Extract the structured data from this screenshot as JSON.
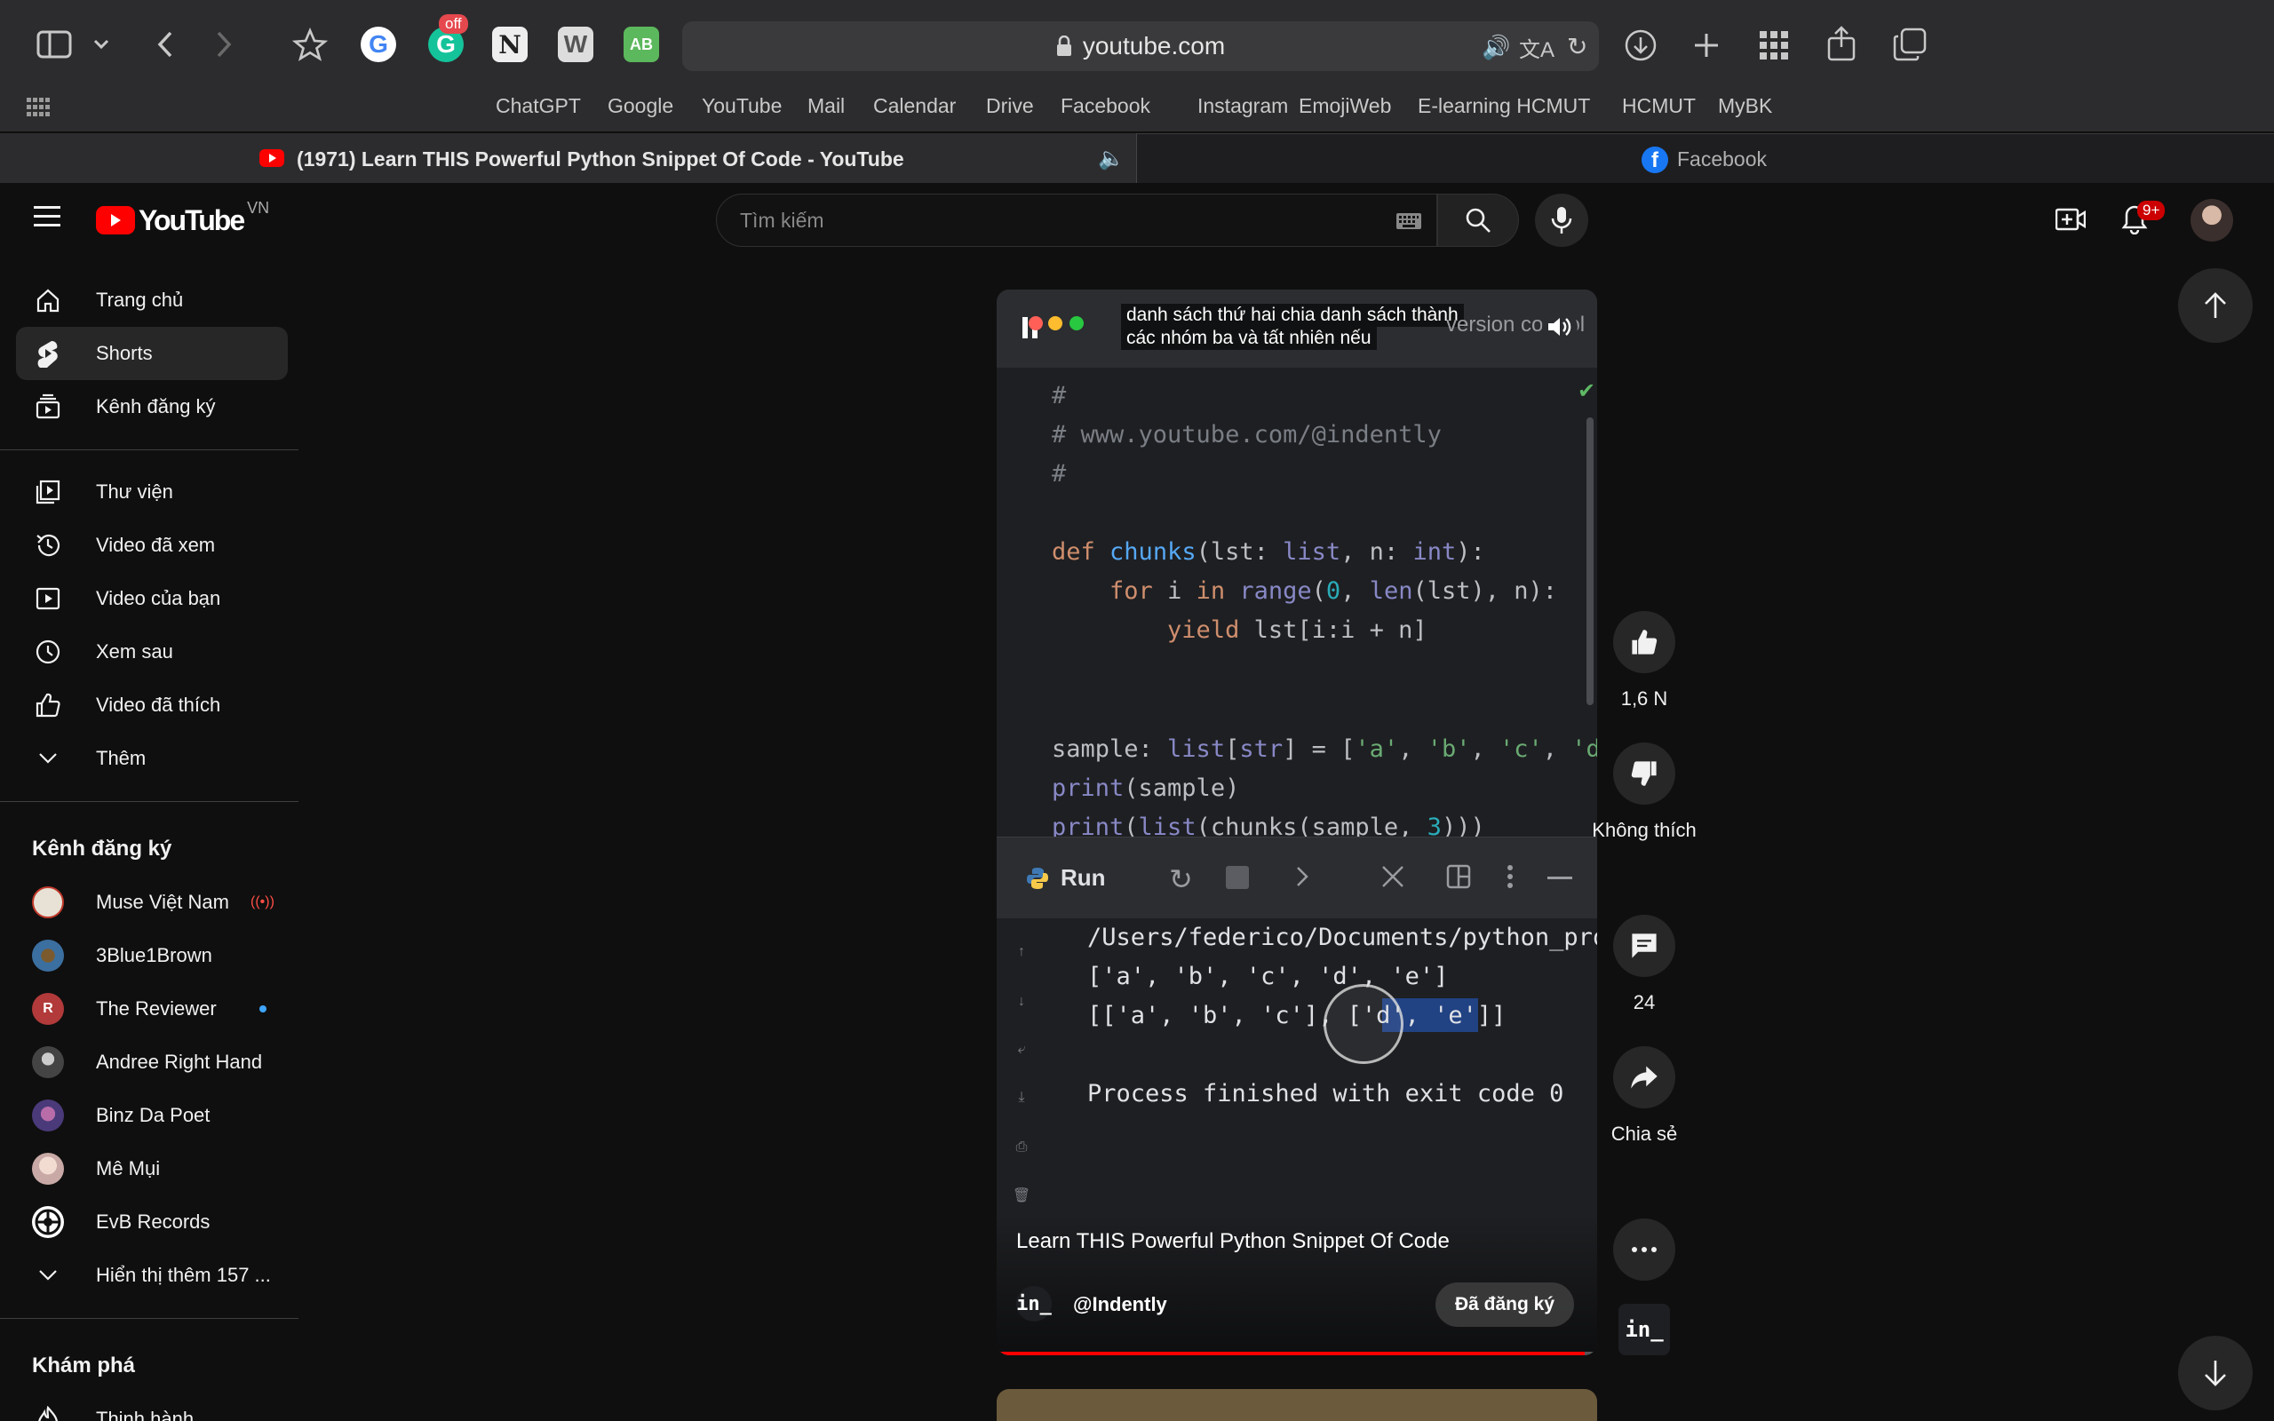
{
  "browser": {
    "address": "youtube.com",
    "extensions": {
      "grammarly_badge": "off"
    },
    "favorites": [
      "ChatGPT",
      "Google",
      "YouTube",
      "Mail",
      "Calendar",
      "Drive",
      "Facebook",
      "Instagram",
      "EmojiWeb",
      "E-learning HCMUT",
      "HCMUT",
      "MyBK"
    ],
    "tabs": [
      {
        "title": "(1971) Learn THIS Powerful Python Snippet Of Code - YouTube",
        "active": true
      },
      {
        "title": "Facebook",
        "active": false
      }
    ]
  },
  "youtube": {
    "logo_text": "YouTube",
    "region": "VN",
    "search_placeholder": "Tìm kiếm",
    "notification_count": "9+"
  },
  "sidebar": {
    "main": [
      {
        "label": "Trang chủ",
        "icon": "home-icon"
      },
      {
        "label": "Shorts",
        "icon": "shorts-icon",
        "selected": true
      },
      {
        "label": "Kênh đăng ký",
        "icon": "subscriptions-icon"
      }
    ],
    "library": [
      {
        "label": "Thư viện",
        "icon": "library-icon"
      },
      {
        "label": "Video đã xem",
        "icon": "history-icon"
      },
      {
        "label": "Video của bạn",
        "icon": "your-videos-icon"
      },
      {
        "label": "Xem sau",
        "icon": "watch-later-icon"
      },
      {
        "label": "Video đã thích",
        "icon": "liked-icon"
      },
      {
        "label": "Thêm",
        "icon": "chevron-down-icon"
      }
    ],
    "subscriptions_heading": "Kênh đăng ký",
    "subscriptions": [
      {
        "name": "Muse Việt Nam",
        "status": "live",
        "color": "#e8e2d6"
      },
      {
        "name": "3Blue1Brown",
        "status": "",
        "color": "#3b6fa0"
      },
      {
        "name": "The Reviewer",
        "status": "new",
        "color": "#b23a3a"
      },
      {
        "name": "Andree Right Hand",
        "status": "",
        "color": "#555555"
      },
      {
        "name": "Binz Da Poet",
        "status": "",
        "color": "#4a3a7a"
      },
      {
        "name": "Mê Mụi",
        "status": "",
        "color": "#c9a9a6"
      },
      {
        "name": "EvB Records",
        "status": "",
        "color": "#ffffff"
      }
    ],
    "show_more": "Hiển thị thêm 157 ...",
    "explore_heading": "Khám phá",
    "explore": [
      {
        "label": "Thịnh hành",
        "icon": "trending-icon"
      }
    ]
  },
  "short": {
    "caption": [
      "danh sách thứ hai chia danh sách thành",
      "các nhóm ba và tất nhiên nếu"
    ],
    "ide_title_partial": "version control",
    "code_lines": [
      "#",
      "# www.youtube.com/@indently",
      "#",
      "",
      "def chunks(lst: list, n: int):",
      "    for i in range(0, len(lst), n):",
      "        yield lst[i:i + n]",
      "",
      "",
      "sample: list[str] = ['a', 'b', 'c', 'd'",
      "print(sample)",
      "print(list(chunks(sample, 3)))"
    ],
    "run_label": "Run",
    "console_lines": [
      "/Users/federico/Documents/python_pro",
      "['a', 'b', 'c', 'd', 'e']",
      "[['a', 'b', 'c'], ['d', 'e']]",
      "",
      "Process finished with exit code 0"
    ],
    "title": "Learn THIS Powerful Python Snippet Of Code",
    "channel_handle": "@Indently",
    "channel_logo_text": "in_",
    "subscribe_label": "Đã đăng ký",
    "progress": 0.98
  },
  "actions": {
    "like_count": "1,6 N",
    "dislike_label": "Không thích",
    "comment_count": "24",
    "share_label": "Chia sẻ"
  },
  "colors": {
    "yt_red": "#ff0000",
    "keyword": "#cf8e6d",
    "function": "#56a8f5",
    "string": "#6aab73",
    "number": "#2aacb8",
    "comment": "#7a7e85",
    "builtin": "#8888c6"
  }
}
